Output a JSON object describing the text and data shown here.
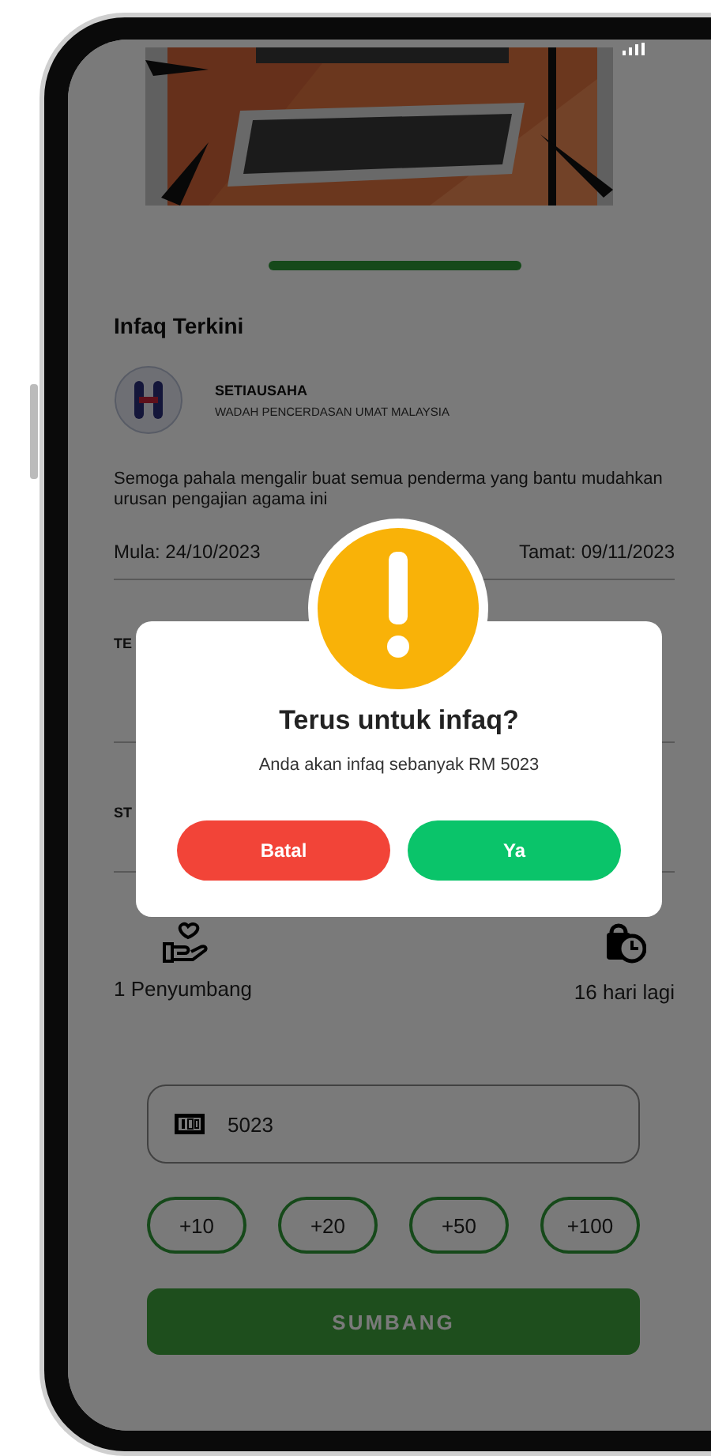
{
  "section_title": "Infaq Terkini",
  "organizer": {
    "name": "SETIAUSAHA",
    "subtitle": "WADAH PENCERDASAN UMAT MALAYSIA"
  },
  "description": "Semoga pahala mengalir buat semua penderma yang bantu mudahkan urusan pengajian agama ini",
  "dates": {
    "start": "Mula: 24/10/2023",
    "end": "Tamat: 09/11/2023"
  },
  "fields": [
    {
      "label": "TE"
    },
    {
      "label": "ST"
    }
  ],
  "stats": {
    "donors": "1 Penyumbang",
    "remaining": "16 hari lagi"
  },
  "amount_field": {
    "value": "5023"
  },
  "quick_amounts": [
    "+10",
    "+20",
    "+50",
    "+100"
  ],
  "submit_button": {
    "label": "SUMBANG"
  },
  "dialog": {
    "title": "Terus untuk infaq?",
    "message": "Anda akan infaq sebanyak RM 5023",
    "buttons": [
      {
        "label": "Batal",
        "kind": "cancel"
      },
      {
        "label": "Ya",
        "kind": "confirm"
      }
    ]
  }
}
